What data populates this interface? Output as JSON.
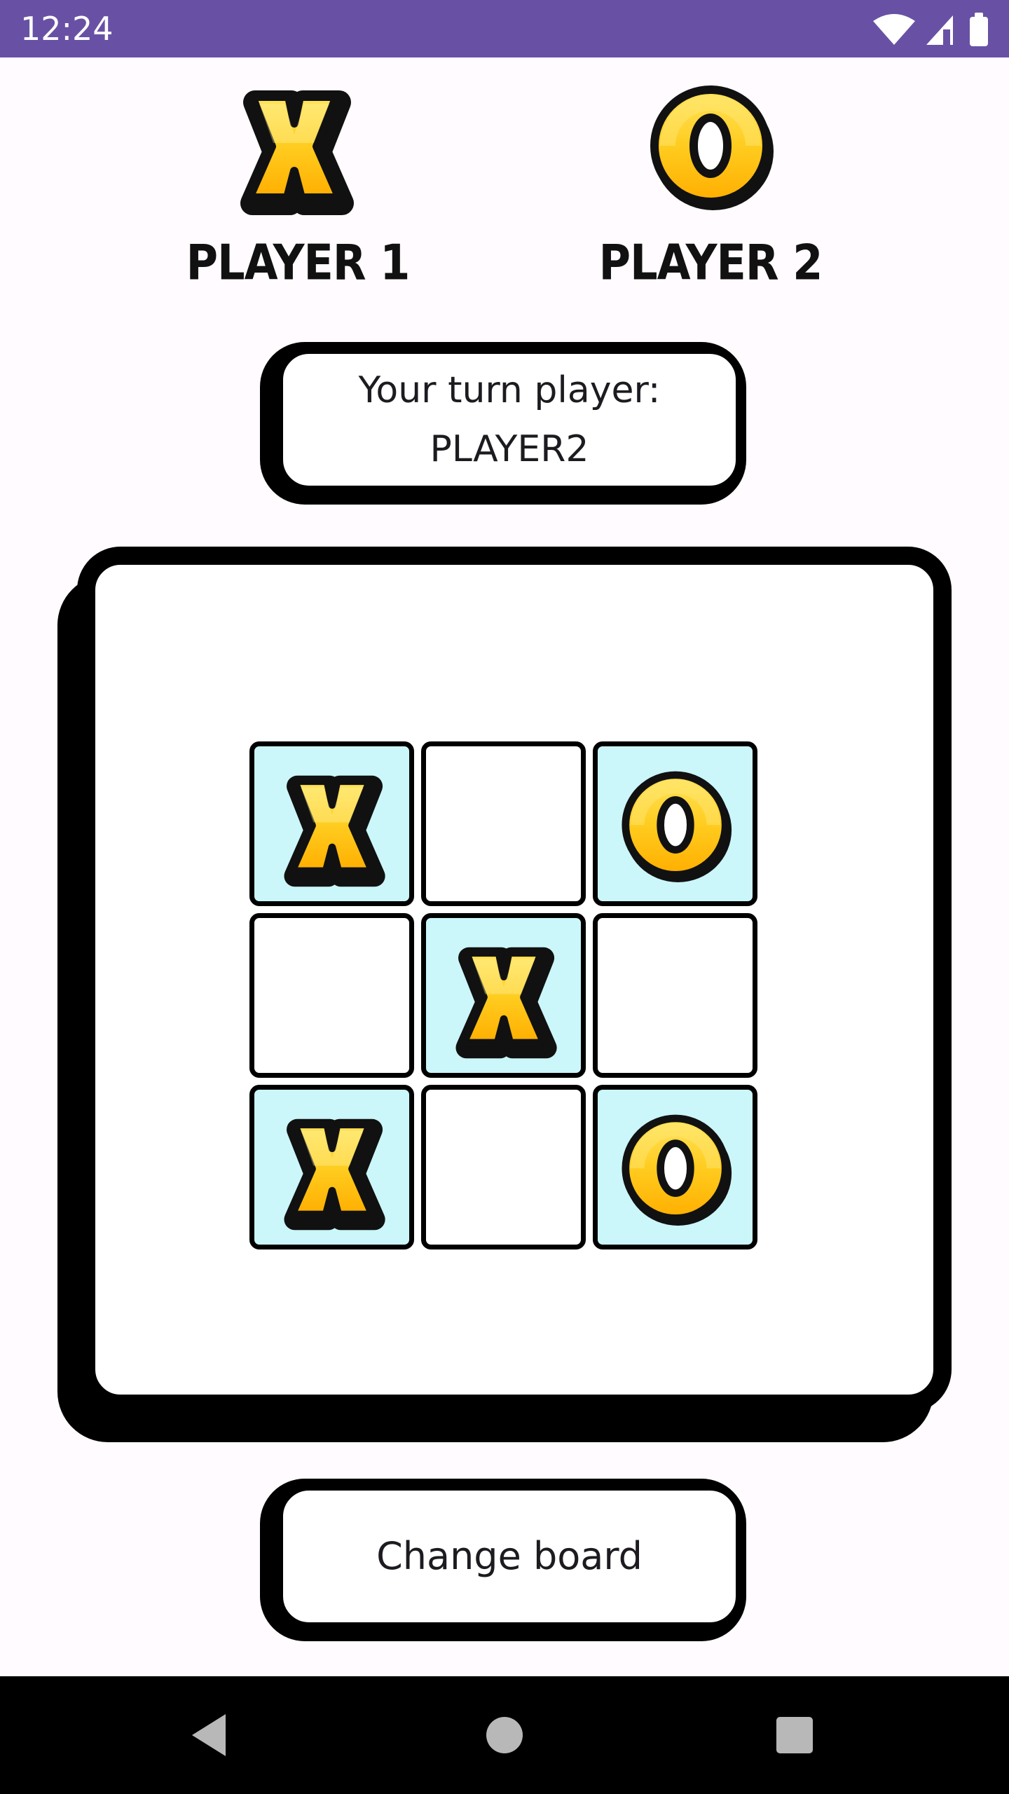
{
  "status_bar": {
    "time": "12:24",
    "icons": [
      "wifi-icon",
      "signal-icon",
      "battery-icon"
    ]
  },
  "players": [
    {
      "label": "PLAYER 1",
      "symbol": "X"
    },
    {
      "label": "PLAYER 2",
      "symbol": "O"
    }
  ],
  "turn": {
    "line1": "Your turn player:",
    "line2": "PLAYER2"
  },
  "board": {
    "cells": [
      "X",
      "",
      "O",
      "",
      "X",
      "",
      "X",
      "",
      "O"
    ],
    "filled_color": "#cbf6fa",
    "empty_color": "#ffffff"
  },
  "change_board": {
    "label": "Change board"
  },
  "nav_bar": {
    "buttons": [
      "back-icon",
      "home-icon",
      "recents-icon"
    ]
  },
  "colors": {
    "status_bar": "#6851a4",
    "background": "#fffbfe",
    "mark_fill": "#ffc21a",
    "mark_outline": "#111111"
  }
}
